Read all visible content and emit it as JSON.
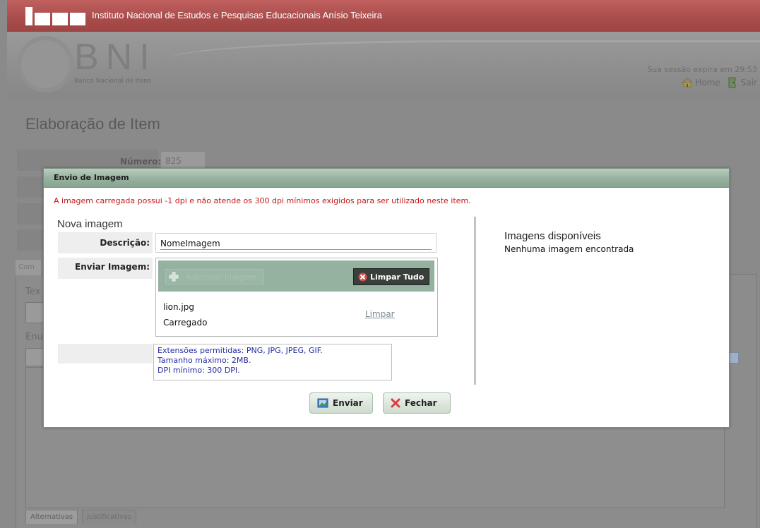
{
  "header": {
    "institute": "Instituto Nacional de Estudos e Pesquisas Educacionais Anísio Teixeira",
    "logo_text": "BNI",
    "logo_subtitle": "Banco Nacional de Itens",
    "session_text": "Sua sessão expira em 29:53",
    "home_label": "Home",
    "exit_label": "Sair"
  },
  "page": {
    "title": "Elaboração de Item",
    "number_label": "Número:",
    "number_value": "825",
    "tab_partial": "Com",
    "text_partial": "Tex",
    "enun_partial": "Enu",
    "dropdown_partial": "--",
    "bottom_tabs": [
      "Alternativas",
      "Justificativas"
    ]
  },
  "modal": {
    "title": "Envio de Imagem",
    "error": "A imagem carregada possui -1 dpi e não atende os 300 dpi mínimos exigidos para ser utilizado neste item.",
    "section_title": "Nova imagem",
    "description_label": "Descrição:",
    "description_value": "NomeImagem",
    "upload_label": "Enviar Imagem:",
    "add_files_label": "Adicionar Imagem",
    "clear_all_label": "Limpar Tudo",
    "file": {
      "name": "lion.jpg",
      "status": "Carregado",
      "clear_label": "Limpar"
    },
    "info": [
      "Extensões permitidas: PNG, JPG, JPEG, GIF.",
      "Tamanho máximo: 2MB.",
      "DPI mínimo: 300 DPI."
    ],
    "available_title": "Imagens disponíveis",
    "available_empty": "Nenhuma imagem encontrada",
    "send_label": "Enviar",
    "close_label": "Fechar"
  },
  "colors": {
    "topbar_red": "#a84c4b",
    "error_red": "#c3171a",
    "modal_header_green": "#98b3a1",
    "info_blue": "#262da0"
  }
}
